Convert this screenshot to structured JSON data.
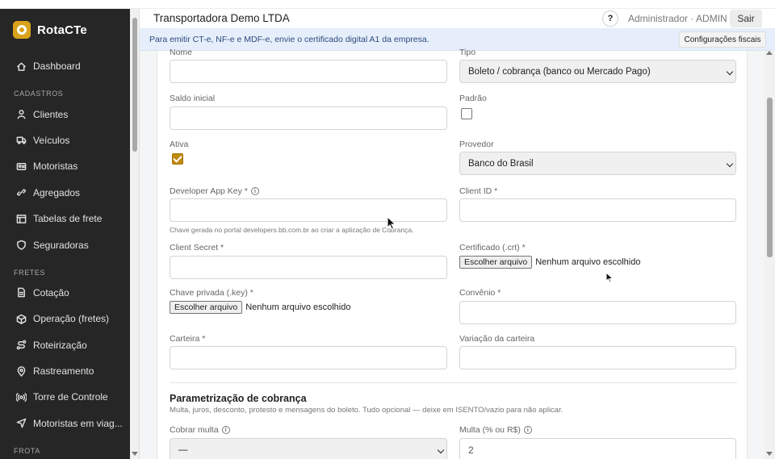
{
  "sidebar": {
    "brand": "RotaCTe",
    "items": [
      {
        "type": "item",
        "label": "Dashboard",
        "icon": "home-icon"
      },
      {
        "type": "section",
        "label": "CADASTROS"
      },
      {
        "type": "item",
        "label": "Clientes",
        "icon": "user-icon"
      },
      {
        "type": "item",
        "label": "Veículos",
        "icon": "truck-icon"
      },
      {
        "type": "item",
        "label": "Motoristas",
        "icon": "id-card-icon"
      },
      {
        "type": "item",
        "label": "Agregados",
        "icon": "link-icon"
      },
      {
        "type": "item",
        "label": "Tabelas de frete",
        "icon": "table-icon"
      },
      {
        "type": "item",
        "label": "Seguradoras",
        "icon": "shield-icon"
      },
      {
        "type": "section",
        "label": "FRETES"
      },
      {
        "type": "item",
        "label": "Cotação",
        "icon": "document-icon"
      },
      {
        "type": "item",
        "label": "Operação (fretes)",
        "icon": "box-icon"
      },
      {
        "type": "item",
        "label": "Roteirização",
        "icon": "route-icon"
      },
      {
        "type": "item",
        "label": "Rastreamento",
        "icon": "map-pin-icon"
      },
      {
        "type": "item",
        "label": "Torre de Controle",
        "icon": "broadcast-icon"
      },
      {
        "type": "item",
        "label": "Motoristas em viag...",
        "icon": "navigation-icon"
      },
      {
        "type": "section",
        "label": "FROTA"
      }
    ]
  },
  "header": {
    "company": "Transportadora Demo LTDA",
    "help": "?",
    "user": "Administrador · ADMIN",
    "logout": "Sair"
  },
  "banner": {
    "text": "Para emitir CT-e, NF-e e MDF-e, envie o certificado digital A1 da empresa.",
    "button": "Configurações fiscais"
  },
  "form": {
    "nome_label": "Nome",
    "nome_value": "",
    "tipo_label": "Tipo",
    "tipo_value": "Boleto / cobrança (banco ou Mercado Pago)",
    "saldo_label": "Saldo inicial",
    "saldo_value": "",
    "padrao_label": "Padrão",
    "padrao_checked": false,
    "ativa_label": "Ativa",
    "ativa_checked": true,
    "provedor_label": "Provedor",
    "provedor_value": "Banco do Brasil",
    "dev_key_label": "Developer App Key *",
    "dev_key_hint": "Chave gerada no portal developers.bb.com.br ao criar a aplicação de Cobrança.",
    "client_id_label": "Client ID *",
    "client_secret_label": "Client Secret *",
    "cert_label": "Certificado (.crt) *",
    "file_button": "Escolher arquivo",
    "file_none": "Nenhum arquivo escolhido",
    "private_key_label": "Chave privada (.key) *",
    "convenio_label": "Convênio *",
    "carteira_label": "Carteira *",
    "variacao_label": "Variação da carteira"
  },
  "cobranca": {
    "title": "Parametrização de cobrança",
    "description": "Multa, juros, desconto, protesto e mensagens do boleto. Tudo opcional — deixe em ISENTO/vazio para não aplicar.",
    "cobrar_multa_label": "Cobrar multa",
    "cobrar_multa_value": "—",
    "multa_label": "Multa (% ou R$)",
    "multa_value": "2"
  }
}
